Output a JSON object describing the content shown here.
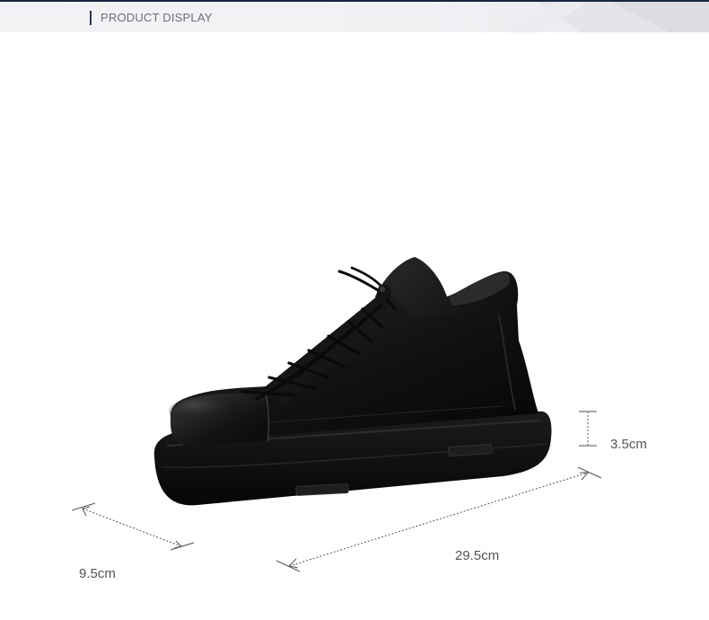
{
  "header": {
    "title": "PRODUCT DISPLAY",
    "accent_color": "#1b2440"
  },
  "product": {
    "image_subject": "black-leather-high-top-lace-up-boot",
    "color": "#111111"
  },
  "dimensions": {
    "height_label": "3.5cm",
    "length_label": "29.5cm",
    "width_label": "9.5cm"
  }
}
